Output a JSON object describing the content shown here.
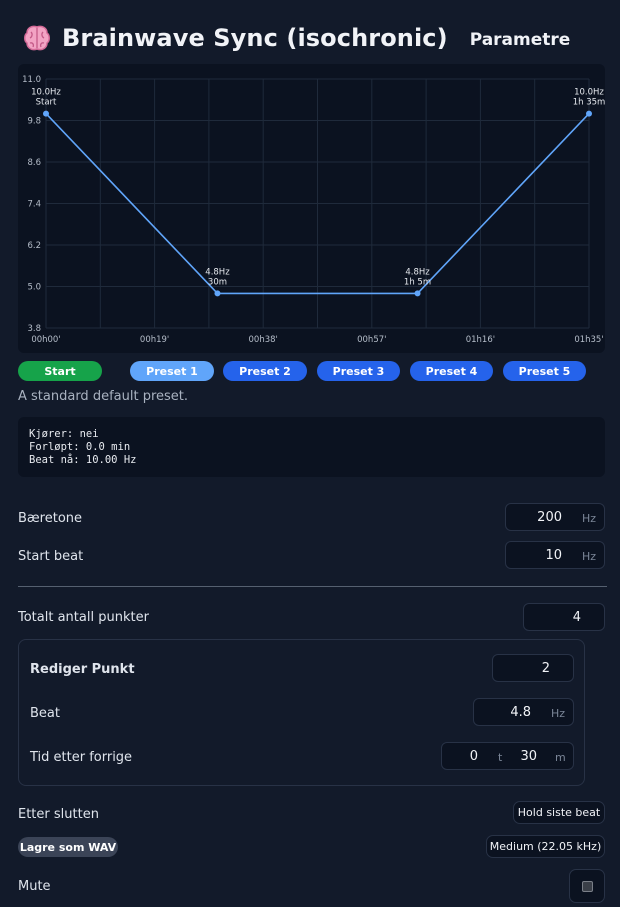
{
  "header": {
    "title": "Brainwave Sync (isochronic)",
    "section": "Parametre",
    "icon": "brain-icon"
  },
  "chart_data": {
    "type": "line",
    "x": [
      "00h00'",
      "00h30'",
      "01h05'",
      "01h35'"
    ],
    "x_minutes": [
      0,
      30,
      65,
      95
    ],
    "y": [
      10.0,
      4.8,
      4.8,
      10.0
    ],
    "point_labels": [
      [
        "10.0Hz",
        "Start"
      ],
      [
        "4.8Hz",
        "30m"
      ],
      [
        "4.8Hz",
        "1h 5m"
      ],
      [
        "10.0Hz",
        "1h 35m"
      ]
    ],
    "x_ticks": [
      "00h00'",
      "00h19'",
      "00h38'",
      "00h57'",
      "01h16'",
      "01h35'"
    ],
    "y_ticks": [
      "11.0",
      "9.8",
      "8.6",
      "7.4",
      "6.2",
      "5.0",
      "3.8"
    ],
    "ylim": [
      3.8,
      11.0
    ],
    "xlim": [
      0,
      95
    ],
    "grid": true,
    "line_color": "#60a5fa"
  },
  "presets": {
    "start_label": "Start",
    "items": [
      "Preset 1",
      "Preset 2",
      "Preset 3",
      "Preset 4",
      "Preset 5"
    ],
    "active": "Preset 1",
    "description": "A standard default preset."
  },
  "status": {
    "running": "Kjører: nei",
    "elapsed": "Forløpt: 0.0 min",
    "beat_now": "Beat nå: 10.00 Hz"
  },
  "params": {
    "carrier_label": "Bæretone",
    "carrier_value": "200",
    "carrier_unit": "Hz",
    "start_beat_label": "Start beat",
    "start_beat_value": "10",
    "start_beat_unit": "Hz",
    "total_points_label": "Totalt antall punkter",
    "total_points_value": "4"
  },
  "edit": {
    "title": "Rediger Punkt",
    "point_value": "2",
    "beat_label": "Beat",
    "beat_value": "4.8",
    "beat_unit": "Hz",
    "time_label": "Tid etter forrige",
    "hours_value": "0",
    "hours_unit": "t",
    "minutes_value": "30",
    "minutes_unit": "m"
  },
  "after": {
    "label": "Etter slutten",
    "value": "Hold siste beat"
  },
  "export": {
    "label": "Lagre som WAV",
    "quality": "Medium (22.05 kHz)"
  },
  "mute": {
    "label": "Mute",
    "checked": false
  }
}
